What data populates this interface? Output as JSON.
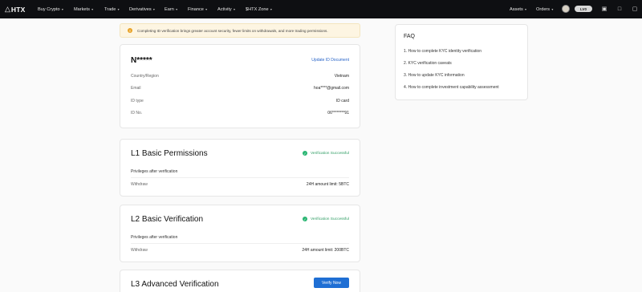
{
  "nav": {
    "logo": "HTX",
    "items": [
      {
        "label": "Buy Crypto"
      },
      {
        "label": "Markets"
      },
      {
        "label": "Trade"
      },
      {
        "label": "Derivatives"
      },
      {
        "label": "Earn"
      },
      {
        "label": "Finance"
      },
      {
        "label": "Activity"
      },
      {
        "label": "$HTX Zone"
      }
    ],
    "right": [
      {
        "label": "Assets"
      },
      {
        "label": "Orders"
      }
    ],
    "badge": "LV0",
    "icons": [
      "user-avatar",
      "level-badge",
      "document-icon",
      "download-icon",
      "bell-icon"
    ]
  },
  "notice": {
    "text": "Completing ID verification brings greater account security, fewer limits on withdrawals, and more trading permissions.",
    "icon": "warning-icon"
  },
  "identity": {
    "name": "N*****",
    "update_link": "Update ID Document",
    "rows": [
      {
        "label": "Country/Region",
        "value": "Vietnam"
      },
      {
        "label": "Email",
        "value": "hoa****@gmail.com"
      },
      {
        "label": "ID type",
        "value": "ID card"
      },
      {
        "label": "ID No.",
        "value": "06********91"
      }
    ]
  },
  "levels": {
    "l1": {
      "title": "L1 Basic Permissions",
      "status": "Verification Successful",
      "privileges": "Privileges after verification",
      "label": "Withdraw",
      "value": "24H amount limit: 5BTC"
    },
    "l2": {
      "title": "L2 Basic Verification",
      "status": "Verification Successful",
      "privileges": "Privileges after verification",
      "label": "Withdraw",
      "value": "24H amount limit: 200BTC"
    },
    "l3": {
      "title": "L3 Advanced Verification",
      "button": "Verify Now"
    }
  },
  "faq": {
    "title": "FAQ",
    "items": [
      {
        "label": "1. How to complete KYC identity verification"
      },
      {
        "label": "2. KYC verification caveats"
      },
      {
        "label": "3. How to update KYC information"
      },
      {
        "label": "4. How to complete investment capability assessment"
      }
    ]
  },
  "colors": {
    "nav_bg": "#0e0f12",
    "accent": "#1f6fd4",
    "success": "#2bb673",
    "warning": "#e8a227"
  }
}
